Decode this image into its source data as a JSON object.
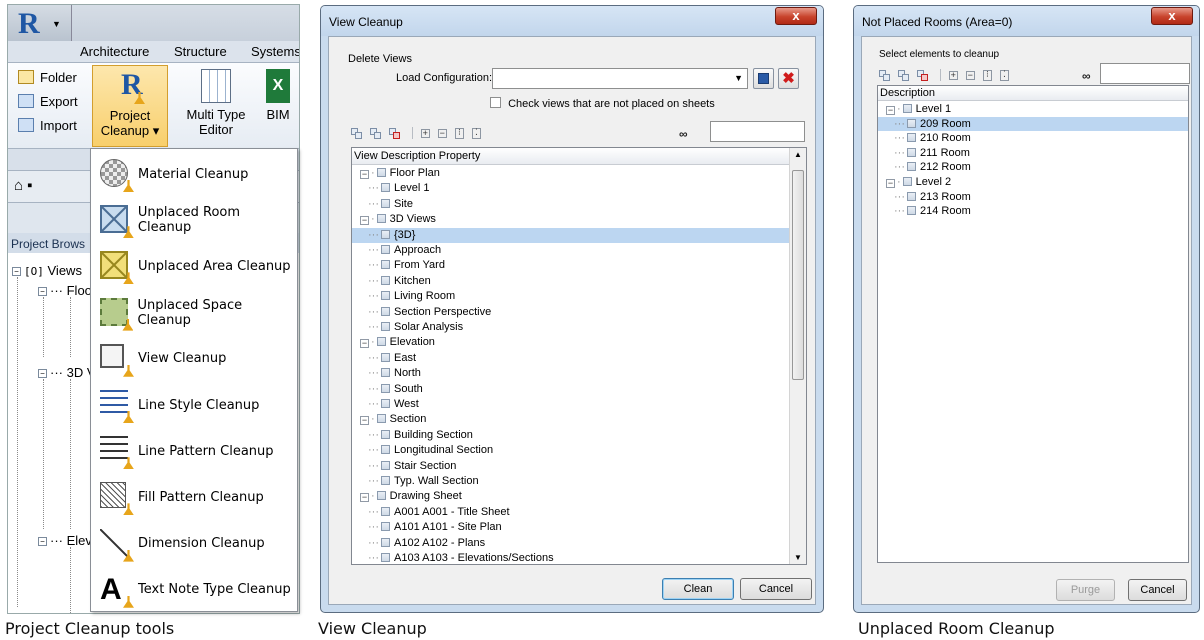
{
  "captions": {
    "project_cleanup": "Project Cleanup tools",
    "view_cleanup": "View Cleanup",
    "unplaced_room": "Unplaced Room Cleanup"
  },
  "revit": {
    "app_letter": "R",
    "tabs": [
      "Architecture",
      "Structure",
      "Systems"
    ],
    "small_buttons": [
      "Folder",
      "Export",
      "Import"
    ],
    "project_cleanup_line1": "Project",
    "project_cleanup_line2": "Cleanup",
    "multi_type_line1": "Multi Type",
    "multi_type_line2": "Editor",
    "bim_label": "BIM",
    "project_browser_label": "Project Brows",
    "tree": {
      "views": "Views",
      "floor": "Floo",
      "threed": "3D V",
      "elev": "Elev"
    },
    "menu_items": [
      {
        "label": "Material Cleanup",
        "icon": "material-sphere-icon"
      },
      {
        "label": "Unplaced Room Cleanup",
        "icon": "room-icon"
      },
      {
        "label": "Unplaced Area Cleanup",
        "icon": "area-icon"
      },
      {
        "label": "Unplaced Space Cleanup",
        "icon": "space-icon"
      },
      {
        "label": "View Cleanup",
        "icon": "view-icon"
      },
      {
        "label": "Line Style Cleanup",
        "icon": "line-style-icon"
      },
      {
        "label": "Line Pattern Cleanup",
        "icon": "line-pattern-icon"
      },
      {
        "label": "Fill Pattern Cleanup",
        "icon": "fill-pattern-icon"
      },
      {
        "label": "Dimension Cleanup",
        "icon": "dimension-icon"
      },
      {
        "label": "Text Note Type Cleanup",
        "icon": "text-note-icon"
      }
    ]
  },
  "view_cleanup": {
    "title": "View Cleanup",
    "close": "x",
    "group_label": "Delete Views",
    "load_config_label": "Load Configuration:",
    "load_config_value": "",
    "check_label": "Check views that are not placed on sheets",
    "column_header": "View Description Property",
    "rows": [
      {
        "text": "Floor Plan",
        "level": 0,
        "expander": "−"
      },
      {
        "text": "Level 1",
        "level": 1
      },
      {
        "text": "Site",
        "level": 1
      },
      {
        "text": "3D Views",
        "level": 0,
        "expander": "−"
      },
      {
        "text": "{3D}",
        "level": 1,
        "selected": true
      },
      {
        "text": "Approach",
        "level": 1
      },
      {
        "text": "From Yard",
        "level": 1
      },
      {
        "text": "Kitchen",
        "level": 1
      },
      {
        "text": "Living Room",
        "level": 1
      },
      {
        "text": "Section Perspective",
        "level": 1
      },
      {
        "text": "Solar Analysis",
        "level": 1
      },
      {
        "text": "Elevation",
        "level": 0,
        "expander": "−"
      },
      {
        "text": "East",
        "level": 1
      },
      {
        "text": "North",
        "level": 1
      },
      {
        "text": "South",
        "level": 1
      },
      {
        "text": "West",
        "level": 1
      },
      {
        "text": "Section",
        "level": 0,
        "expander": "−"
      },
      {
        "text": "Building Section",
        "level": 1
      },
      {
        "text": "Longitudinal Section",
        "level": 1
      },
      {
        "text": "Stair Section",
        "level": 1
      },
      {
        "text": "Typ. Wall Section",
        "level": 1
      },
      {
        "text": "Drawing Sheet",
        "level": 0,
        "expander": "−"
      },
      {
        "text": "A001 A001 - Title Sheet",
        "level": 1
      },
      {
        "text": "A101 A101 - Site Plan",
        "level": 1
      },
      {
        "text": "A102 A102 - Plans",
        "level": 1
      },
      {
        "text": "A103 A103 - Elevations/Sections",
        "level": 1
      }
    ],
    "clean_label": "Clean",
    "cancel_label": "Cancel"
  },
  "not_placed": {
    "title": "Not Placed Rooms (Area=0)",
    "close": "x",
    "group_label": "Select elements to cleanup",
    "column_header": "Description",
    "rows": [
      {
        "text": "Level 1",
        "level": 0,
        "expander": "−"
      },
      {
        "text": "209 Room",
        "level": 1,
        "selected": true
      },
      {
        "text": "210 Room",
        "level": 1
      },
      {
        "text": "211 Room",
        "level": 1
      },
      {
        "text": "212 Room",
        "level": 1
      },
      {
        "text": "Level 2",
        "level": 0,
        "expander": "−"
      },
      {
        "text": "213 Room",
        "level": 1
      },
      {
        "text": "214 Room",
        "level": 1
      }
    ],
    "purge_label": "Purge",
    "cancel_label": "Cancel"
  },
  "colors": {
    "selection": "#bcd6f1",
    "close_red": "#c8432c",
    "accent_blue": "#1f57a4",
    "broom": "#e7a51b"
  }
}
